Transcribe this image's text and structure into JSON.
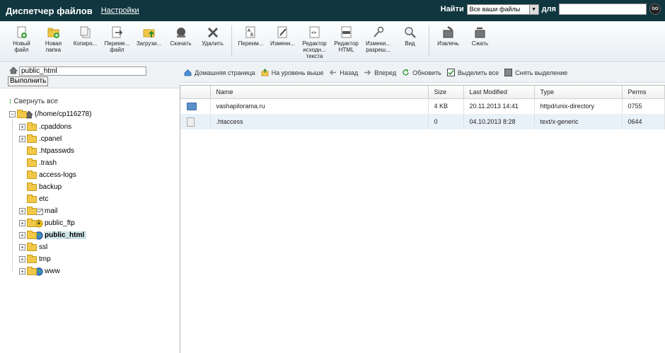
{
  "header": {
    "title": "Диспетчер файлов",
    "settings_link": "Настройки",
    "search_label": "Найти",
    "search_scope": "Все ваши файлы",
    "search_for_label": "для",
    "go_label": "GO"
  },
  "toolbar": [
    {
      "label": "Новый файл",
      "icon": "new-file-icon"
    },
    {
      "label": "Новая папка",
      "icon": "new-folder-icon"
    },
    {
      "label": "Копиро...",
      "icon": "copy-icon"
    },
    {
      "label": "Переме... файл",
      "icon": "move-icon"
    },
    {
      "label": "Загрузи...",
      "icon": "upload-icon"
    },
    {
      "label": "Скачать",
      "icon": "download-icon"
    },
    {
      "label": "Удалить",
      "icon": "delete-icon"
    },
    {
      "label": "Переим...",
      "icon": "rename-icon"
    },
    {
      "label": "Измени...",
      "icon": "edit-icon"
    },
    {
      "label": "Редактор исходн... текста",
      "icon": "code-editor-icon"
    },
    {
      "label": "Редактор HTML",
      "icon": "html-editor-icon"
    },
    {
      "label": "Измени... разреш...",
      "icon": "permissions-icon"
    },
    {
      "label": "Вид",
      "icon": "view-icon"
    },
    {
      "label": "Извлечь",
      "icon": "extract-icon"
    },
    {
      "label": "Сжать",
      "icon": "compress-icon"
    }
  ],
  "path": {
    "value": "public_html",
    "go_button": "Выполнить"
  },
  "actions": [
    {
      "label": "Домашняя страница",
      "icon": "home-icon"
    },
    {
      "label": "На уровень выше",
      "icon": "up-level-icon"
    },
    {
      "label": "Назад",
      "icon": "back-arrow-icon"
    },
    {
      "label": "Вперед",
      "icon": "forward-arrow-icon"
    },
    {
      "label": "Обновить",
      "icon": "refresh-icon"
    },
    {
      "label": "Выделить все",
      "icon": "checkbox-checked-icon"
    },
    {
      "label": "Снять выделение",
      "icon": "checkbox-unchecked-icon"
    }
  ],
  "tree": {
    "collapse_label": "Свернуть все",
    "root": "(/home/cp116278)",
    "items": [
      {
        "label": ".cpaddons",
        "expandable": true,
        "overlay": ""
      },
      {
        "label": ".cpanel",
        "expandable": true,
        "overlay": ""
      },
      {
        "label": ".htpasswds",
        "expandable": false,
        "overlay": ""
      },
      {
        "label": ".trash",
        "expandable": false,
        "overlay": ""
      },
      {
        "label": "access-logs",
        "expandable": false,
        "overlay": ""
      },
      {
        "label": "backup",
        "expandable": false,
        "overlay": ""
      },
      {
        "label": "etc",
        "expandable": false,
        "overlay": ""
      },
      {
        "label": "mail",
        "expandable": true,
        "overlay": "mail"
      },
      {
        "label": "public_ftp",
        "expandable": true,
        "overlay": "ftp"
      },
      {
        "label": "public_html",
        "expandable": true,
        "overlay": "globe",
        "selected": true
      },
      {
        "label": "ssl",
        "expandable": true,
        "overlay": ""
      },
      {
        "label": "tmp",
        "expandable": true,
        "overlay": ""
      },
      {
        "label": "www",
        "expandable": true,
        "overlay": "globe"
      }
    ]
  },
  "table": {
    "columns": [
      "",
      "Name",
      "Size",
      "Last Modified",
      "Type",
      "Perms"
    ],
    "rows": [
      {
        "icon": "folder-icon",
        "name": "vashapilorama.ru",
        "size": "4 KB",
        "modified": "20.11.2013 14:41",
        "type": "httpd/unix-directory",
        "perms": "0755"
      },
      {
        "icon": "text-file-icon",
        "name": ".htaccess",
        "size": "0",
        "modified": "04.10.2013 8:28",
        "type": "text/x-generic",
        "perms": "0644"
      }
    ]
  },
  "colors": {
    "header_bg": "#10363f",
    "selection_bg": "#cfe6e8",
    "alt_row_bg": "#e9f1f8"
  }
}
